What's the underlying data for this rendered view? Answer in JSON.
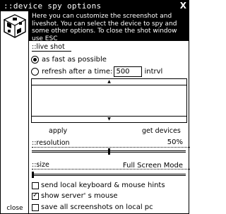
{
  "window": {
    "title": "::device spy options",
    "close_symbol": "X"
  },
  "sidebar": {
    "logo_icon": "device-spy-logo-icon",
    "close_label": "close"
  },
  "info": {
    "text": "Here you can customize the screenshot and liveshot. You can select the device to spy and some other options. To close the shot window use ESC"
  },
  "live_shot": {
    "label": "::live shot",
    "option_fast": "as fast as possible",
    "option_refresh": "refresh after a time:",
    "interval_value": "500",
    "interval_unit": "intrvl",
    "selected": "fast"
  },
  "device_list": {
    "items": []
  },
  "buttons": {
    "apply": "apply",
    "get_devices": "get devices"
  },
  "resolution": {
    "label": "::resolution",
    "value": "50%",
    "level": 0.5
  },
  "size": {
    "label": "::size",
    "value": "Full Screen Mode",
    "level": 0.0
  },
  "options": {
    "send_hints": {
      "label": "send local keyboard & mouse hints",
      "checked": false
    },
    "show_mouse": {
      "label": "show server' s mouse",
      "checked": true
    },
    "save_all": {
      "label": "save all screenshots on local pc",
      "checked": false
    }
  },
  "colors": {
    "background": "#ffffff",
    "foreground": "#000000"
  }
}
